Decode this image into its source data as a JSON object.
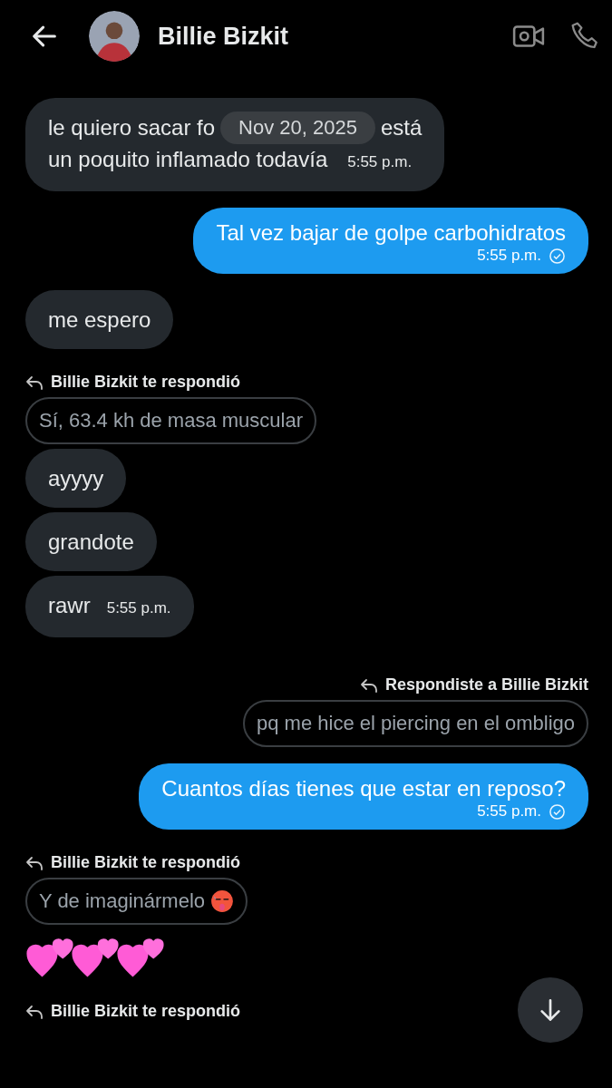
{
  "header": {
    "title": "Billie Bizkit"
  },
  "messages": [
    {
      "outgoing": false,
      "kind": "split",
      "line_1": [
        "le quiero sacar fo",
        "está"
      ],
      "date_pill": "Nov 20, 2025",
      "line_2": "un poquito inflamado todavía",
      "time": "5:55 p.m."
    },
    {
      "outgoing": true,
      "kind": "text",
      "text": "Tal vez bajar de golpe carbohidratos",
      "time": "5:55 p.m.",
      "read": true
    },
    {
      "outgoing": false,
      "kind": "text",
      "text": "me espero"
    },
    {
      "outgoing": false,
      "kind": "reply",
      "label": "Billie Bizkit te respondió",
      "quote": "Sí,  63.4 kh de masa muscular"
    },
    {
      "outgoing": false,
      "kind": "text",
      "text": "ayyyy"
    },
    {
      "outgoing": false,
      "kind": "text",
      "text": "grandote"
    },
    {
      "outgoing": false,
      "kind": "text",
      "text": "rawr",
      "time": "5:55 p.m."
    },
    {
      "outgoing": true,
      "kind": "reply",
      "label": "Respondiste a Billie Bizkit",
      "quote": "pq me hice el piercing en el ombligo"
    },
    {
      "outgoing": true,
      "kind": "text",
      "text": "Cuantos días tienes que estar en reposo?",
      "time": "5:55 p.m.",
      "read": true
    },
    {
      "outgoing": false,
      "kind": "reply",
      "label": "Billie Bizkit te respondió",
      "quote": "Y de imaginármelo",
      "emoji": true
    },
    {
      "outgoing": false,
      "kind": "hearts"
    },
    {
      "outgoing": false,
      "kind": "reply-label",
      "label": "Billie Bizkit te respondió"
    }
  ]
}
